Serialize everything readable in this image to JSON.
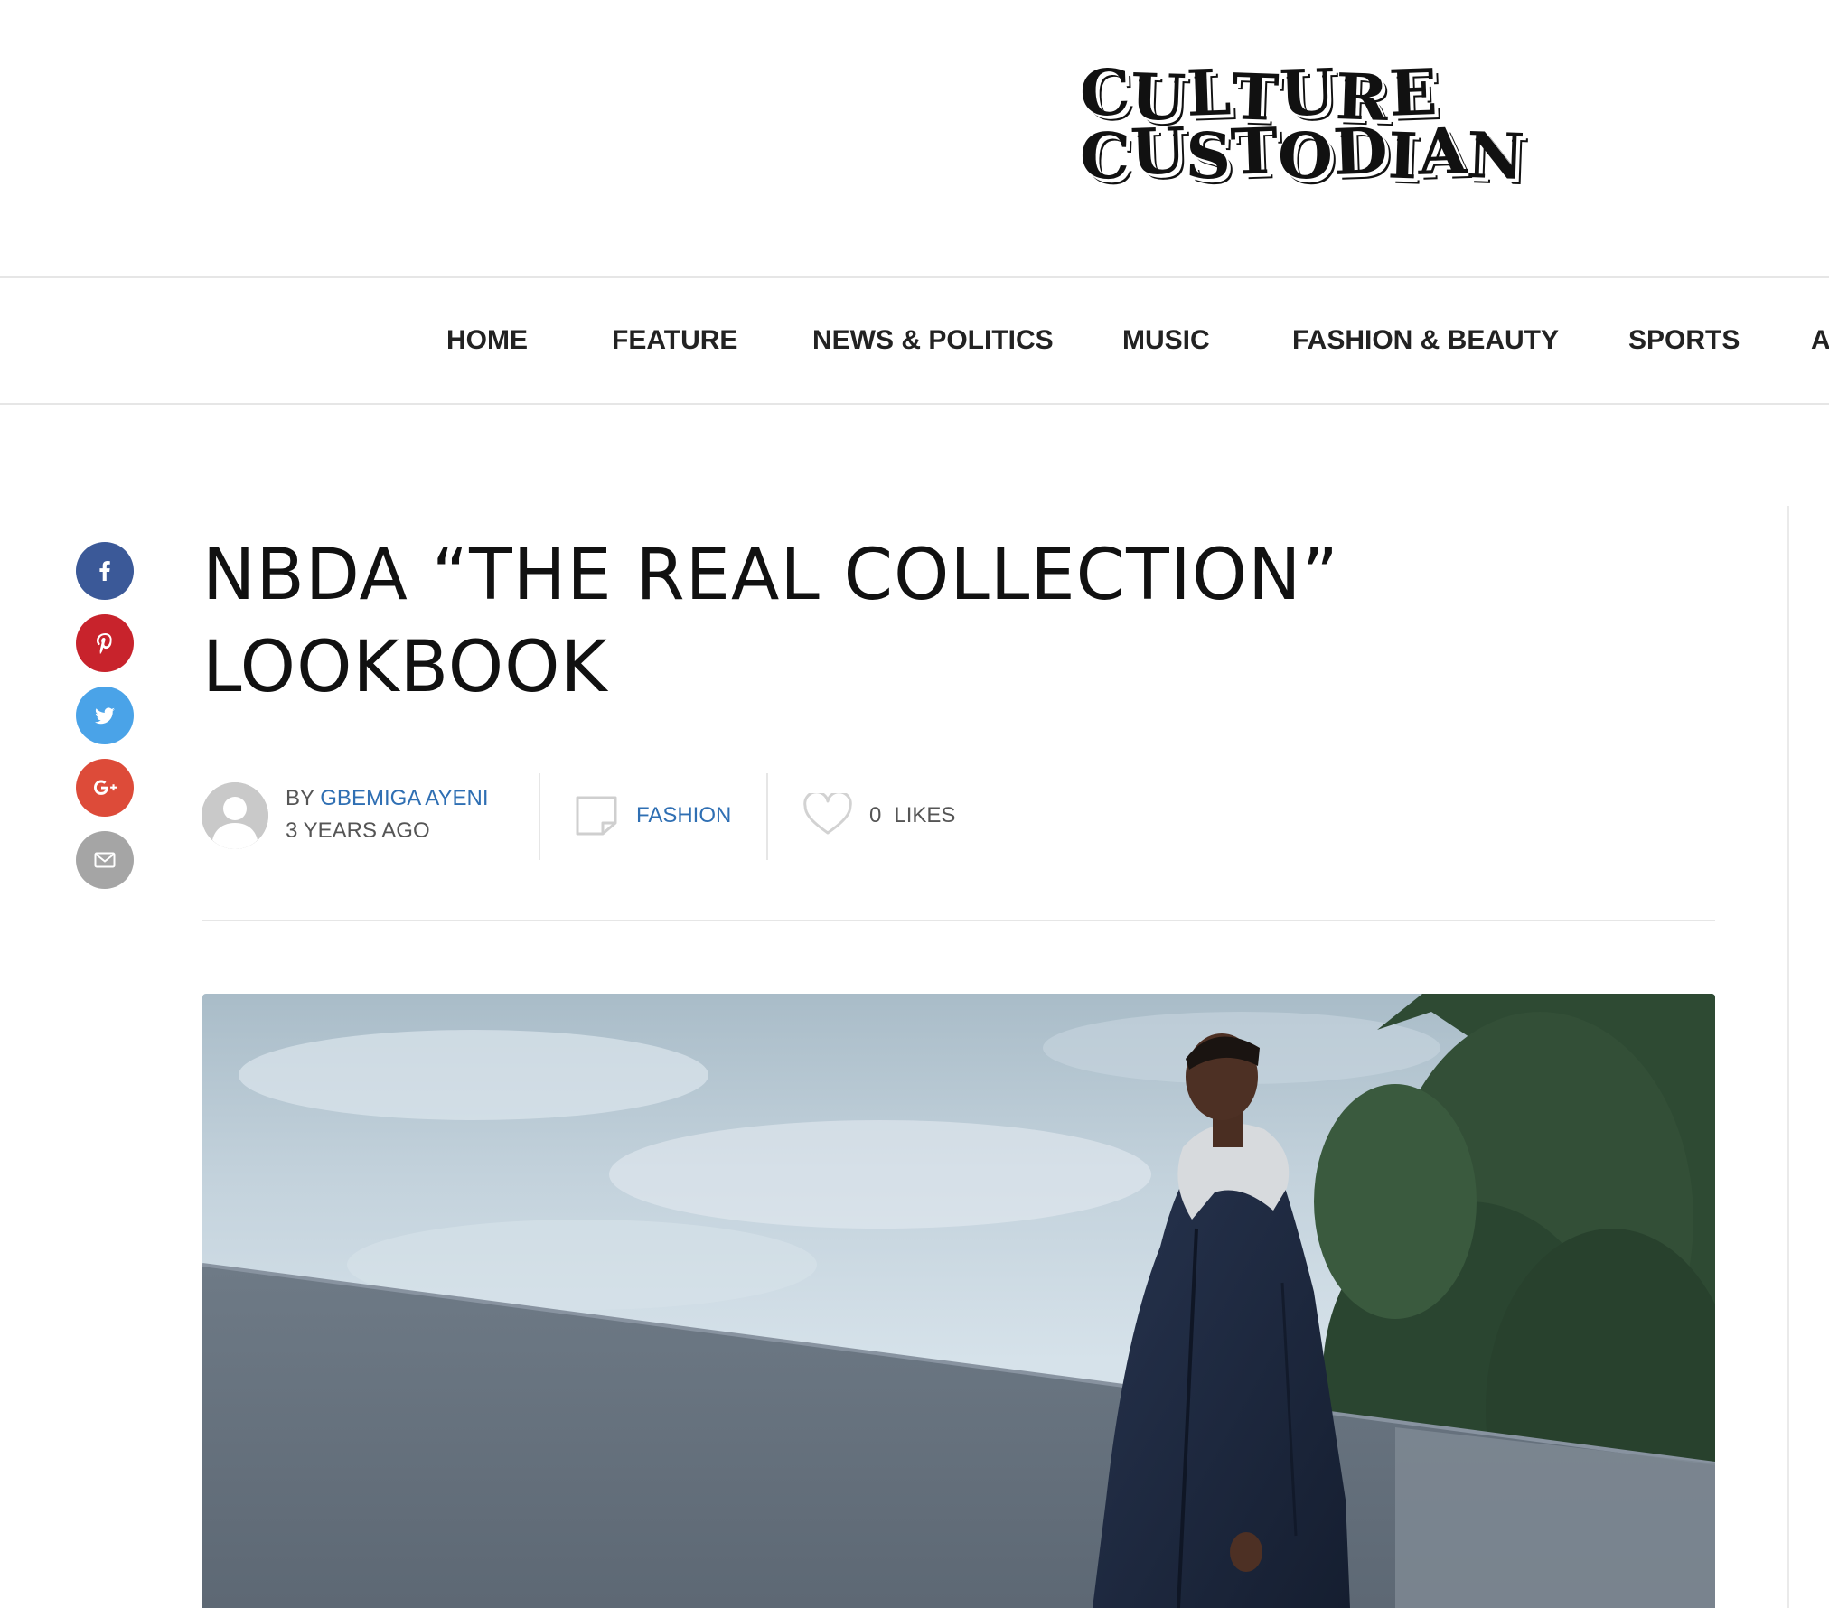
{
  "logo": {
    "line1": [
      "C",
      "U",
      "L",
      "T",
      "U",
      "R",
      "E"
    ],
    "line2": [
      "C",
      "U",
      "S",
      "T",
      "O",
      "D",
      "I",
      "A",
      "N"
    ]
  },
  "nav": {
    "items": [
      {
        "label": "HOME"
      },
      {
        "label": "FEATURE"
      },
      {
        "label": "NEWS & POLITICS"
      },
      {
        "label": "MUSIC"
      },
      {
        "label": "FASHION & BEAUTY"
      },
      {
        "label": "SPORTS"
      },
      {
        "label": "A"
      }
    ]
  },
  "share": {
    "items": [
      {
        "icon": "facebook-icon",
        "color": "#3b5998"
      },
      {
        "icon": "pinterest-icon",
        "color": "#c8232c"
      },
      {
        "icon": "twitter-icon",
        "color": "#4aa3e8"
      },
      {
        "icon": "google-plus-icon",
        "color": "#dd4b39"
      },
      {
        "icon": "email-icon",
        "color": "#a5a5a5"
      }
    ]
  },
  "post": {
    "title_line1": "NBDA “THE REAL COLLECTION”",
    "title_line2": "LOOKBOOK",
    "by_prefix": "BY",
    "author": "GBEMIGA AYENI",
    "time": "3 YEARS AGO",
    "category": "FASHION",
    "likes_count": "0",
    "likes_label": "LIKES"
  },
  "colors": {
    "link": "#2f6fb3",
    "text": "#111111",
    "muted": "#555555"
  }
}
